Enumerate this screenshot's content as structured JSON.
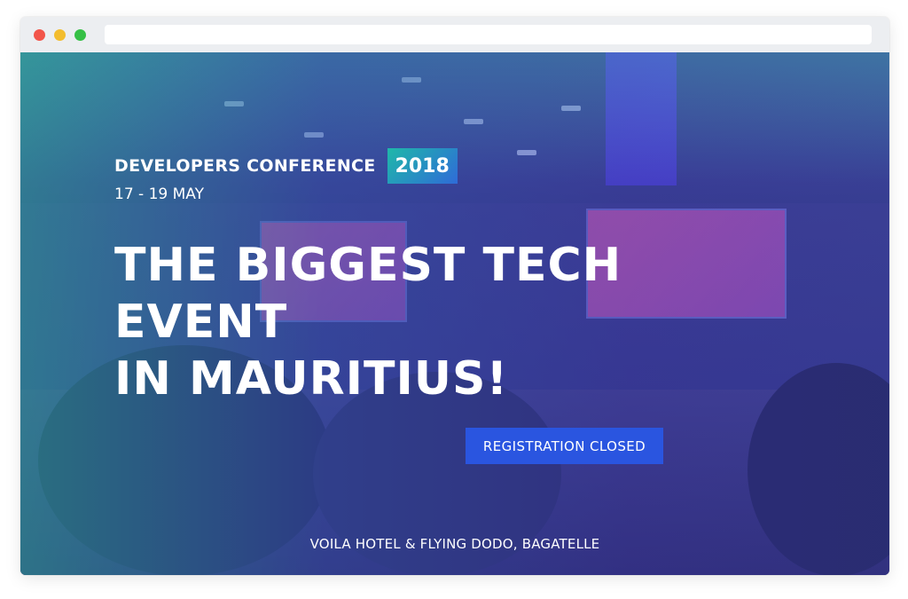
{
  "event": {
    "conference_name": "DEVELOPERS CONFERENCE",
    "year": "2018",
    "dates": "17 - 19 MAY",
    "headline_line1": "THE BIGGEST TECH EVENT",
    "headline_line2": "IN MAURITIUS!",
    "registration_label": "REGISTRATION CLOSED",
    "venue": "VOILA HOTEL & FLYING DODO, BAGATELLE"
  },
  "colors": {
    "accent_button": "#2a55e0",
    "badge_gradient_start": "#1fb8a9",
    "badge_gradient_end": "#2f6bd8",
    "window_close": "#f2554a",
    "window_minimize": "#f3bd2e",
    "window_maximize": "#36c046"
  },
  "icons": [
    "window-close-icon",
    "window-minimize-icon",
    "window-maximize-icon"
  ]
}
